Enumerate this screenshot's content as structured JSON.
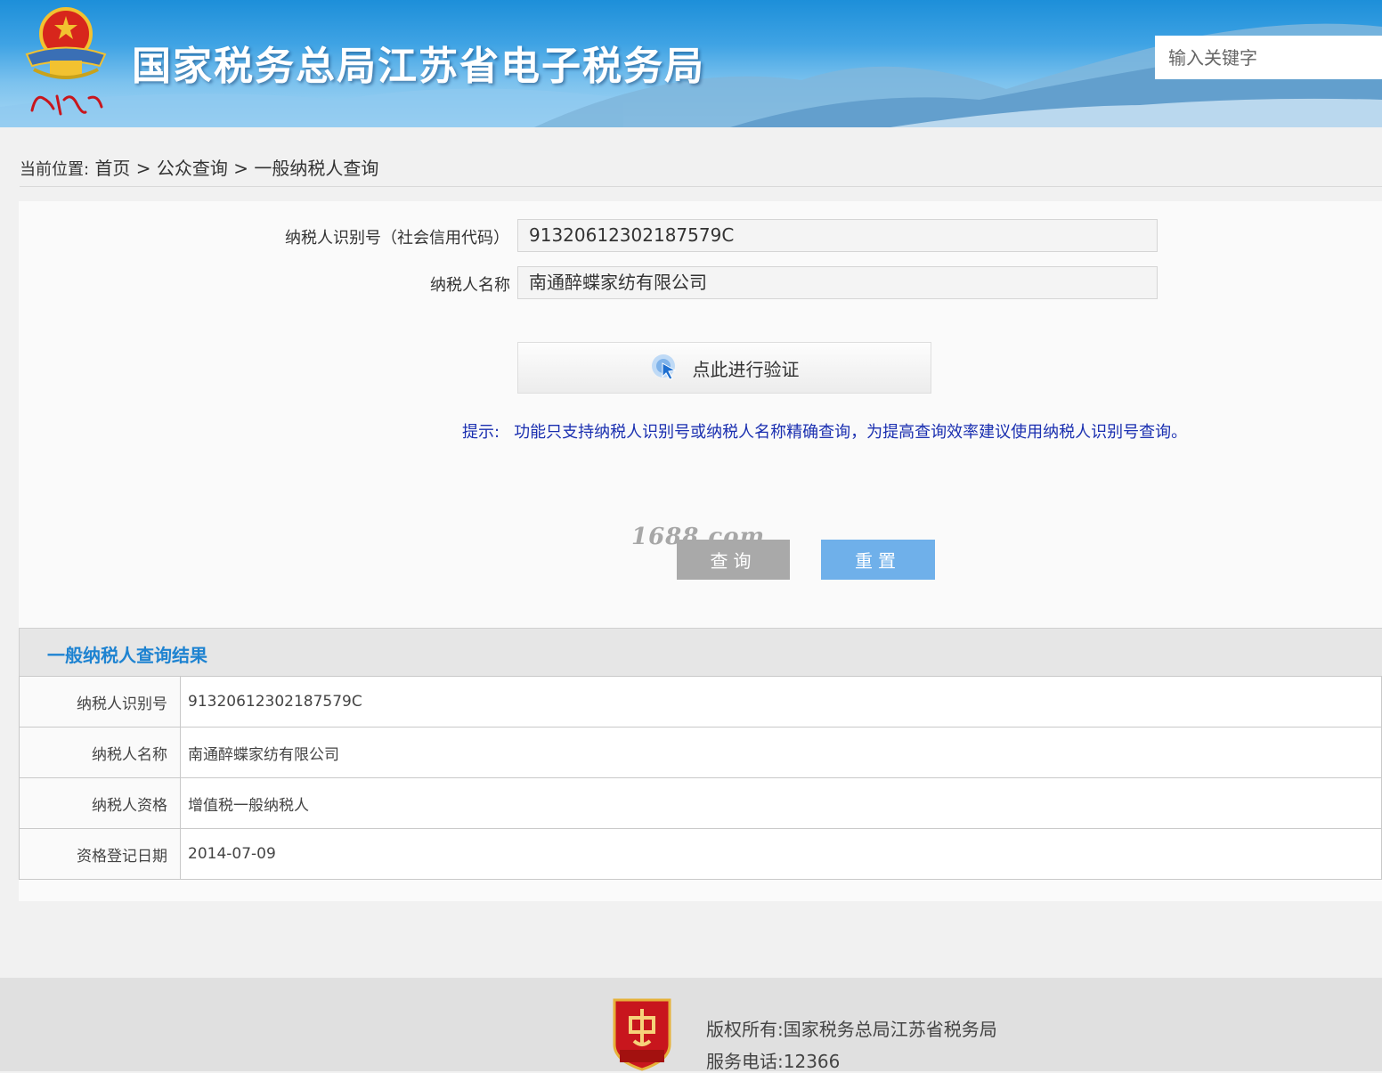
{
  "header": {
    "brand_script": "中国税务",
    "site_title": "国家税务总局江苏省电子税务局",
    "search_placeholder": "输入关键字"
  },
  "breadcrumb": {
    "label": "当前位置:",
    "items": [
      "首页",
      "公众查询",
      "一般纳税人查询"
    ],
    "separator": ">"
  },
  "form": {
    "taxpayer_id_label": "纳税人识别号（社会信用代码）",
    "taxpayer_id_value": "91320612302187579C",
    "taxpayer_name_label": "纳税人名称",
    "taxpayer_name_value": "南通醉蝶家纺有限公司",
    "verify_label": "点此进行验证",
    "hint_label": "提示:",
    "hint_text": "功能只支持纳税人识别号或纳税人名称精确查询，为提高查询效率建议使用纳税人识别号查询。",
    "query_button": "查询",
    "reset_button": "重置"
  },
  "watermark": "1688.com",
  "result": {
    "title": "一般纳税人查询结果",
    "rows": [
      {
        "key": "纳税人识别号",
        "value": "91320612302187579C"
      },
      {
        "key": "纳税人名称",
        "value": "南通醉蝶家纺有限公司"
      },
      {
        "key": "纳税人资格",
        "value": "增值税一般纳税人"
      },
      {
        "key": "资格登记日期",
        "value": "2014-07-09"
      }
    ]
  },
  "footer": {
    "emblem_text": "党政机关",
    "copyright_label": "版权所有:",
    "copyright_value": "国家税务总局江苏省税务局",
    "phone_label": "服务电话:",
    "phone_value": "12366"
  },
  "colors": {
    "header_blue": "#2a96dc",
    "result_title": "#1e83d1",
    "hint": "#1a2fb0",
    "reset_button": "#6fb0ea",
    "query_button": "#a9a9a9"
  }
}
